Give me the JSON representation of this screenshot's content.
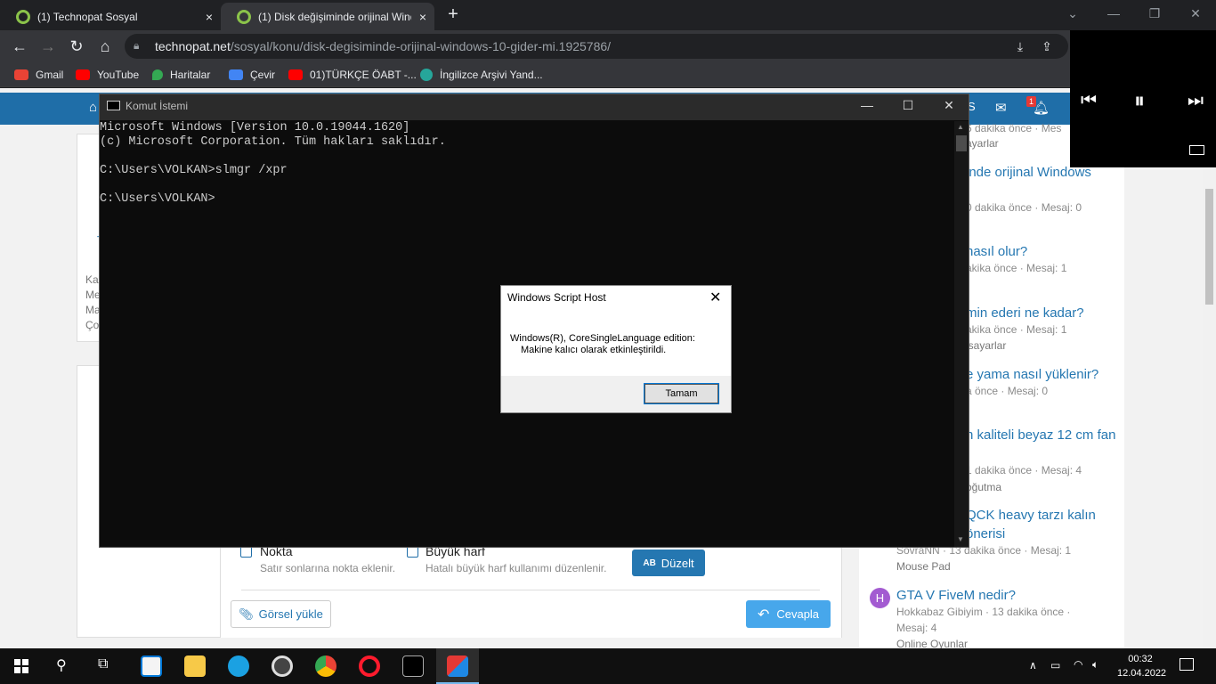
{
  "browser": {
    "tabs": [
      {
        "title": "(1) Technopat Sosyal",
        "close": "×"
      },
      {
        "title": "(1) Disk değişiminde orijinal Wind",
        "close": "×"
      }
    ],
    "new_tab": "+",
    "url_domain": "technopat.net",
    "url_path": "/sosyal/konu/disk-degisiminde-orijinal-windows-10-gider-mi.1925786/",
    "bookmarks": [
      {
        "label": "Gmail",
        "icon": "gmail-icon",
        "color": "#ea4335"
      },
      {
        "label": "YouTube",
        "icon": "youtube-icon",
        "color": "#ff0000"
      },
      {
        "label": "Haritalar",
        "icon": "maps-icon",
        "color": "#34a853"
      },
      {
        "label": "Çevir",
        "icon": "translate-icon",
        "color": "#4285f4"
      },
      {
        "label": "01)TÜRKÇE ÖABT -...",
        "icon": "youtube-icon",
        "color": "#ff0000"
      },
      {
        "label": "İngilizce Arşivi Yand...",
        "icon": "site-icon",
        "color": "#26a69a"
      }
    ]
  },
  "cmd": {
    "title": "Komut İstemi",
    "lines": [
      "Microsoft Windows [Version 10.0.19044.1620]",
      "(c) Microsoft Corporation. Tüm hakları saklıdır.",
      "",
      "C:\\Users\\VOLKAN>slmgr /xpr",
      "",
      "C:\\Users\\VOLKAN>"
    ]
  },
  "dialog": {
    "title": "Windows Script Host",
    "line1": "Windows(R), CoreSingleLanguage edition:",
    "line2": "Makine kalıcı olarak etkinleştirildi.",
    "ok": "Tamam"
  },
  "editor": {
    "nokta_label": "Nokta",
    "nokta_desc": "Satır sonlarına nokta eklenir.",
    "buyuk_label": "Büyük harf",
    "buyuk_desc": "Hatalı büyük harf kullanımı düzenlenir.",
    "duzelt": "Düzelt",
    "duzelt_icon": "AB",
    "upload": "Görsel yükle",
    "reply": "Cevapla"
  },
  "left_fragments": [
    "Ka",
    "Me",
    "Ma",
    "Ço"
  ],
  "sidebar": {
    "items": [
      {
        "title": "",
        "meta": "6 dakika önce · Mes",
        "sub": "ayarlar"
      },
      {
        "title": "inde orijinal Windows",
        "meta": "0 dakika önce · Mesaj: 0",
        "sub": ""
      },
      {
        "title": "nasıl olur?",
        "meta": "akika önce · Mesaj: 1",
        "sub": ""
      },
      {
        "title": "min ederi ne kadar?",
        "meta": "akika önce · Mesaj: 1",
        "sub": "isayarlar"
      },
      {
        "title": "e yama nasıl yüklenir?",
        "meta": "a önce · Mesaj: 0",
        "sub": ""
      },
      {
        "title": "n kaliteli beyaz 12 cm fan",
        "meta": "1 dakika önce · Mesaj: 4",
        "sub": "oğutma"
      },
      {
        "title": "QCK heavy tarzı kalın",
        "title2": "önerisi",
        "meta": "SovraNN · 13 dakika önce · Mesaj: 1",
        "sub": "Mouse Pad"
      },
      {
        "title": "GTA V FiveM nedir?",
        "meta": "Hokkabaz Gibiyim · 13 dakika önce ·",
        "meta2": "Mesaj: 4",
        "sub": "Online Oyunlar",
        "avatar": "H"
      }
    ]
  },
  "nav_badge": "1",
  "clock": {
    "time": "00:32",
    "date": "12.04.2022"
  }
}
